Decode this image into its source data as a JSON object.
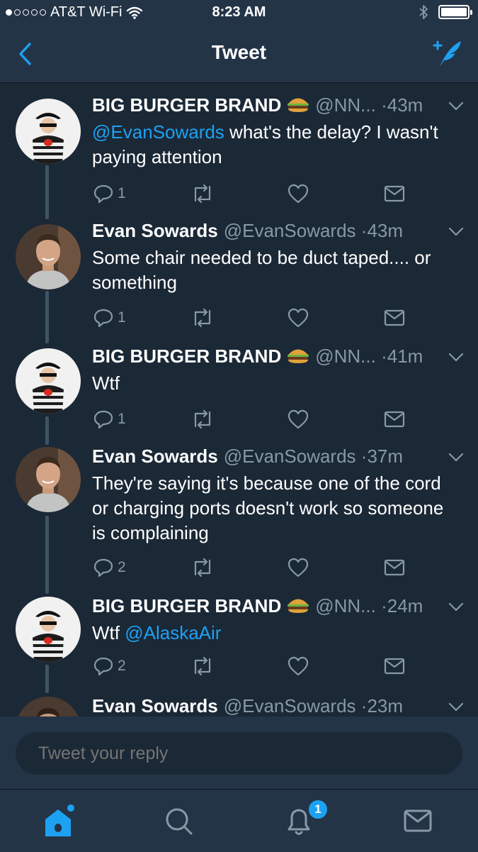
{
  "status_bar": {
    "carrier": "AT&T Wi-Fi",
    "time": "8:23 AM",
    "signal_bars_filled": 1,
    "signal_bars_total": 5
  },
  "nav": {
    "title": "Tweet"
  },
  "tweets": [
    {
      "name": "BIG BURGER BRAND",
      "emoji": "hamburger-icon",
      "handle": "@NN...",
      "time": "43m",
      "text_parts": [
        {
          "mention": "@EvanSowards"
        },
        {
          "text": " what's the delay? I wasn't paying attention"
        }
      ],
      "reply_count": "1"
    },
    {
      "name": "Evan Sowards",
      "handle": "@EvanSowards",
      "time": "43m",
      "text_parts": [
        {
          "text": "Some chair needed to be duct taped.... or something"
        }
      ],
      "reply_count": "1"
    },
    {
      "name": "BIG BURGER BRAND",
      "emoji": "hamburger-icon",
      "handle": "@NN...",
      "time": "41m",
      "text_parts": [
        {
          "text": "Wtf"
        }
      ],
      "reply_count": "1"
    },
    {
      "name": "Evan Sowards",
      "handle": "@EvanSowards",
      "time": "37m",
      "text_parts": [
        {
          "text": "They're saying it's because one of the cord or charging ports doesn't work so someone is complaining"
        }
      ],
      "reply_count": "2"
    },
    {
      "name": "BIG BURGER BRAND",
      "emoji": "hamburger-icon",
      "handle": "@NN...",
      "time": "24m",
      "text_parts": [
        {
          "text": "Wtf "
        },
        {
          "mention": "@AlaskaAir"
        }
      ],
      "reply_count": "2"
    },
    {
      "name": "Evan Sowards",
      "handle": "@EvanSowards",
      "time": "23m",
      "text_parts": [],
      "reply_count": ""
    }
  ],
  "reply": {
    "placeholder": "Tweet your reply"
  },
  "tabbar": {
    "notifications_badge": "1"
  },
  "colors": {
    "background": "#1b2836",
    "bar": "#243447",
    "accent": "#1da1f2",
    "muted": "#8899a6"
  }
}
